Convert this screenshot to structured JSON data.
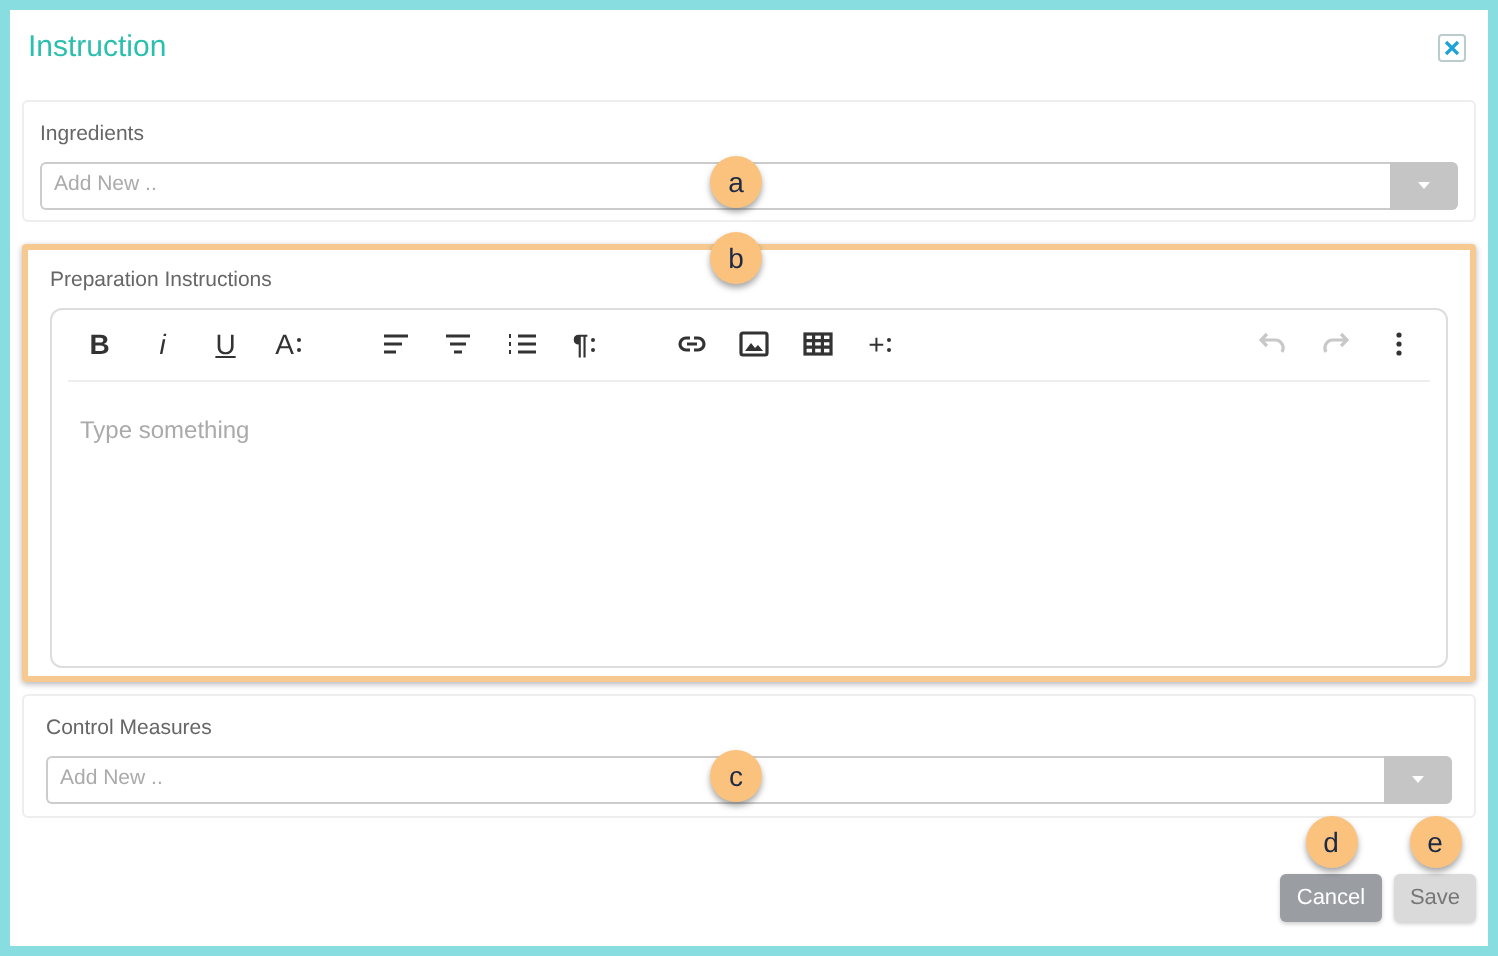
{
  "dialog": {
    "title": "Instruction"
  },
  "ingredients": {
    "label": "Ingredients",
    "placeholder": "Add New ..",
    "callout": "a"
  },
  "preparation": {
    "label": "Preparation Instructions",
    "highlighted": true,
    "callout": "b",
    "placeholder": "Type something",
    "toolbar": [
      {
        "kind": "bold",
        "glyph": "B",
        "disabled": false
      },
      {
        "kind": "italic",
        "glyph": "i",
        "disabled": false
      },
      {
        "kind": "underline",
        "glyph": "U",
        "disabled": false
      },
      {
        "kind": "font-size",
        "glyph": "A",
        "disabled": false
      },
      {
        "kind": "align-left",
        "disabled": false
      },
      {
        "kind": "align-center",
        "disabled": false
      },
      {
        "kind": "ordered-list",
        "disabled": false
      },
      {
        "kind": "paragraph",
        "glyph": "¶",
        "disabled": false
      },
      {
        "kind": "link",
        "disabled": false
      },
      {
        "kind": "image",
        "disabled": false
      },
      {
        "kind": "table",
        "disabled": false
      },
      {
        "kind": "insert",
        "glyph": "+",
        "disabled": false
      },
      {
        "kind": "undo",
        "disabled": true
      },
      {
        "kind": "redo",
        "disabled": true
      },
      {
        "kind": "more",
        "disabled": false
      }
    ]
  },
  "control_measures": {
    "label": "Control Measures",
    "placeholder": "Add New ..",
    "callout": "c"
  },
  "buttons": [
    {
      "label": "Cancel",
      "kind": "cancel",
      "disabled": false,
      "callout": "d"
    },
    {
      "label": "Save",
      "kind": "save",
      "disabled": true,
      "callout": "e"
    }
  ]
}
